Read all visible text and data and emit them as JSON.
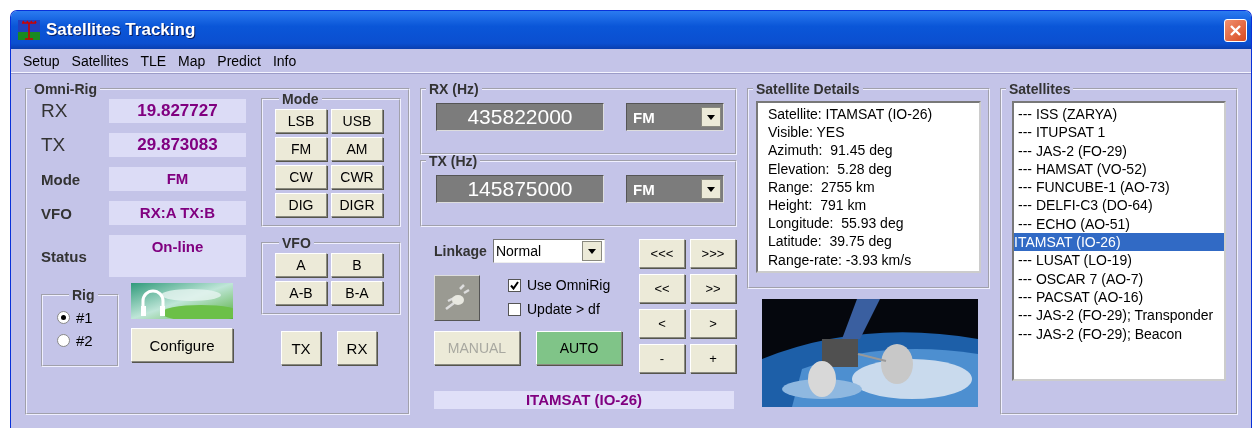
{
  "window": {
    "title": "Satellites Tracking"
  },
  "menu": [
    "Setup",
    "Satellites",
    "TLE",
    "Map",
    "Predict",
    "Info"
  ],
  "omni_rig": {
    "title": "Omni-Rig",
    "fields": [
      {
        "label": "RX",
        "value": "19.827727",
        "kind": "big"
      },
      {
        "label": "TX",
        "value": "29.873083",
        "kind": "big"
      },
      {
        "label": "Mode",
        "value": "FM",
        "kind": "small"
      },
      {
        "label": "VFO",
        "value": "RX:A TX:B",
        "kind": "small"
      },
      {
        "label": "Status",
        "value": "On-line",
        "kind": "tall"
      }
    ],
    "mode_group": {
      "title": "Mode",
      "buttons": [
        "LSB",
        "USB",
        "FM",
        "AM",
        "CW",
        "CWR",
        "DIG",
        "DIGR"
      ]
    },
    "vfo_group": {
      "title": "VFO",
      "buttons": [
        "A",
        "B",
        "A-B",
        "B-A"
      ]
    },
    "rig": {
      "title": "Rig",
      "options": [
        {
          "label": "#1",
          "selected": true
        },
        {
          "label": "#2",
          "selected": false
        }
      ]
    },
    "configure_button": "Configure",
    "tx_button": "TX",
    "rx_button": "RX"
  },
  "rx": {
    "title": "RX (Hz)",
    "frequency": "435822000",
    "mode": "FM"
  },
  "tx": {
    "title": "TX (Hz)",
    "frequency": "145875000",
    "mode": "FM"
  },
  "linkage": {
    "label": "Linkage",
    "value": "Normal"
  },
  "checkboxes": [
    {
      "label": "Use OmniRig",
      "checked": true
    },
    {
      "label": "Update > df",
      "checked": false
    }
  ],
  "manual_button": {
    "label": "MANUAL",
    "disabled": true
  },
  "auto_button": {
    "label": "AUTO",
    "on": true
  },
  "tuning_buttons": [
    "<<<",
    ">>>",
    "<<",
    ">>",
    "<",
    ">",
    "-",
    "+"
  ],
  "selected_satellite": "ITAMSAT (IO-26)",
  "details": {
    "title": "Satellite Details",
    "lines": [
      "Satellite: ITAMSAT (IO-26)",
      "Visible: YES",
      "Azimuth:  91.45 deg",
      "Elevation:  5.28 deg",
      "Range:  2755 km",
      "Height:  791 km",
      "Longitude:  55.93 deg",
      "Latitude:  39.75 deg",
      "Range-rate: -3.93 km/s"
    ]
  },
  "satellites": {
    "title": "Satellites",
    "items": [
      {
        "label": "--- ISS (ZARYA)",
        "selected": false
      },
      {
        "label": "--- ITUPSAT 1",
        "selected": false
      },
      {
        "label": "--- JAS-2 (FO-29)",
        "selected": false
      },
      {
        "label": "--- HAMSAT (VO-52)",
        "selected": false
      },
      {
        "label": "--- FUNCUBE-1 (AO-73)",
        "selected": false
      },
      {
        "label": "--- DELFI-C3 (DO-64)",
        "selected": false
      },
      {
        "label": "--- ECHO (AO-51)",
        "selected": false
      },
      {
        "label": "ITAMSAT (IO-26)",
        "selected": true
      },
      {
        "label": "--- LUSAT (LO-19)",
        "selected": false
      },
      {
        "label": "--- OSCAR 7 (AO-7)",
        "selected": false
      },
      {
        "label": "--- PACSAT (AO-16)",
        "selected": false
      },
      {
        "label": "--- JAS-2 (FO-29); Transponder",
        "selected": false
      },
      {
        "label": "--- JAS-2 (FO-29); Beacon",
        "selected": false
      }
    ]
  }
}
